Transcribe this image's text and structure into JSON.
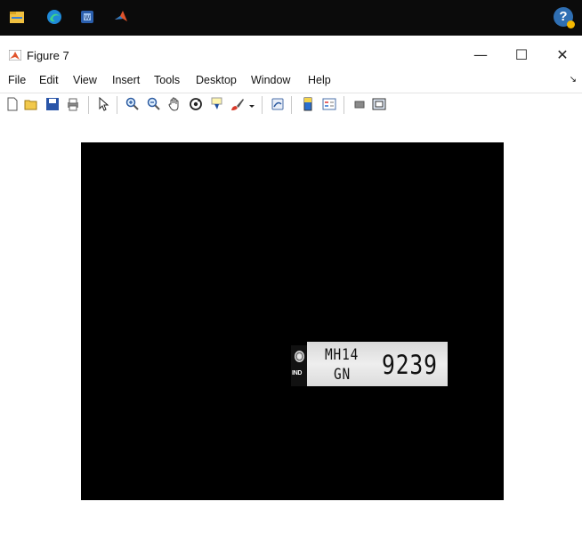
{
  "taskbar": {
    "icons": [
      "file-explorer-icon",
      "edge-browser-icon",
      "word-icon",
      "matlab-icon"
    ],
    "help_icon": "help-icon"
  },
  "window": {
    "title": "Figure 7",
    "controls": {
      "minimize": "—",
      "maximize": "☐",
      "close": "✕"
    }
  },
  "menu": {
    "items": [
      "File",
      "Edit",
      "View",
      "Insert",
      "Tools",
      "Desktop",
      "Window",
      "Help"
    ],
    "overflow": "↘"
  },
  "toolbar": {
    "tools": [
      "new-figure-icon",
      "open-file-icon",
      "save-icon",
      "print-icon",
      "pointer-icon",
      "zoom-in-icon",
      "zoom-out-icon",
      "pan-icon",
      "rotate-3d-icon",
      "data-cursor-icon",
      "brush-icon",
      "dropdown-arrow-icon",
      "link-plot-icon",
      "colorbar-icon",
      "legend-icon",
      "hide-plot-tools-icon",
      "show-plot-tools-icon"
    ]
  },
  "plot": {
    "plate": {
      "emblem_label": "IND",
      "line1": "MH14",
      "line2": "GN",
      "number": "9239"
    }
  },
  "colors": {
    "taskbar": "#0b0b0b",
    "axes_background": "#000000",
    "help_blue": "#2f6fb3"
  }
}
